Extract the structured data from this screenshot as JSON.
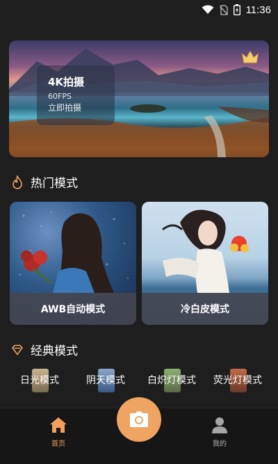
{
  "status_bar": {
    "time": "11:36",
    "icons": [
      "wifi-icon",
      "no-sim-icon",
      "battery-icon"
    ]
  },
  "banner": {
    "title": "4K拍摄",
    "subtitle": "60FPS",
    "cta": "立即拍摄",
    "badge_icon": "crown-icon"
  },
  "hot_section": {
    "icon": "flame-icon",
    "title": "热门模式",
    "cards": [
      {
        "label": "AWB自动模式"
      },
      {
        "label": "冷白皮模式"
      }
    ]
  },
  "classic_section": {
    "icon": "diamond-icon",
    "title": "经典模式",
    "items": [
      {
        "label": "日光模式"
      },
      {
        "label": "阴天模式"
      },
      {
        "label": "白炽灯模式"
      },
      {
        "label": "荧光灯模式"
      }
    ]
  },
  "nav": {
    "home_label": "首页",
    "mine_label": "我的",
    "camera_icon": "camera-icon"
  },
  "colors": {
    "accent": "#f0a461",
    "background": "#1e1e1e",
    "nav_active": "#f0a05c"
  }
}
